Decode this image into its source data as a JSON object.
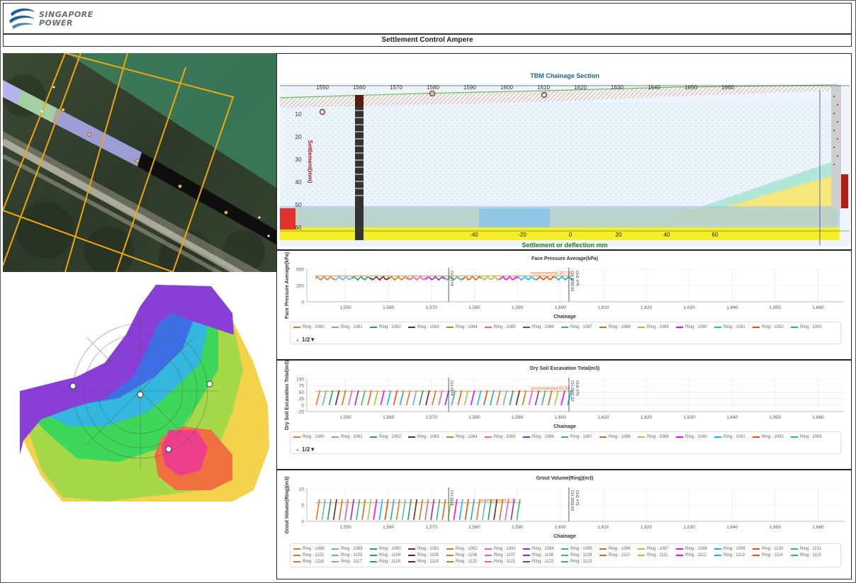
{
  "header": {
    "logo_line1": "SINGAPORE",
    "logo_line2": "POWER",
    "title": "Settlement Control Ampere"
  },
  "colors": {
    "accent_blue": "#1f5f95",
    "recommended": "#e8742a",
    "grid": "#dde3ea"
  },
  "tbm_section": {
    "title": "TBM Chainage Section",
    "chainage_ticks": [
      "1550",
      "1560",
      "1570",
      "1580",
      "1590",
      "1600",
      "1610",
      "1620",
      "1630",
      "1640",
      "1650",
      "1660"
    ],
    "depth_ticks": [
      "10",
      "20",
      "30",
      "40",
      "50",
      "60"
    ],
    "settlement_label": "Settlement(mm)",
    "deflection_label": "Settlement or deflection mm",
    "deflection_ticks": [
      "-40",
      "-20",
      "0",
      "20",
      "40",
      "60"
    ]
  },
  "charts": [
    {
      "id": "face-pressure",
      "title": "Face Pressure Average(kPa)",
      "ylabel": "Face Pressure Average(kPa)",
      "xlabel": "Chainage",
      "yticks": [
        "500",
        "250",
        "0"
      ],
      "ylim": [
        0,
        500
      ],
      "recommended_label": "recommended 397.00",
      "recommended_value": 397,
      "marker_labels": [
        "CH 1574",
        "CH 1602.02",
        "CH1 #75"
      ],
      "legend_page": "1/2"
    },
    {
      "id": "dry-soil",
      "title": "Dry Soil Excavation Total(m3)",
      "ylabel": "Dry Soil Excavation Total(m3)",
      "xlabel": "Chainage",
      "yticks": [
        "100",
        "75",
        "50",
        "25",
        "0",
        "-25"
      ],
      "ylim": [
        -25,
        100
      ],
      "recommended_label": "recommended 53.50",
      "recommended_value": 53.5,
      "marker_labels": [
        "CH 1574",
        "CH 1602.02",
        "CH1 #75"
      ],
      "legend_page": "1/2"
    },
    {
      "id": "grout",
      "title": "Grout Volume(Ring)(m3)",
      "ylabel": "Grout Volume(Ring)(m3)",
      "xlabel": "Chainage",
      "yticks": [
        "10",
        "5",
        "0"
      ],
      "ylim": [
        0,
        10
      ],
      "recommended_label": "recommended 5.70",
      "recommended_value": 5.7,
      "marker_labels": [
        "CH 1574",
        "CH 1602.02",
        "CH1 #75"
      ],
      "legend_page": ""
    }
  ],
  "chart_data": [
    {
      "type": "line",
      "title": "Face Pressure Average(kPa)",
      "xlabel": "Chainage",
      "ylabel": "Face Pressure Average(kPa)",
      "x_ticks": [
        1550,
        1560,
        1570,
        1580,
        1590,
        1600,
        1610,
        1620,
        1630,
        1640,
        1650,
        1660
      ],
      "ylim": [
        0,
        500
      ],
      "recommended": 397,
      "series_note": "one line per ring, Ring : 1080 to Ring : 1093 shown on page 1/2",
      "legend": [
        "Ring : 1080",
        "Ring : 1081",
        "Ring : 1082",
        "Ring : 1083",
        "Ring : 1084",
        "Ring : 1085",
        "Ring : 1086",
        "Ring : 1087",
        "Ring : 1088",
        "Ring : 1089",
        "Ring : 1090",
        "Ring : 1091",
        "Ring : 1092",
        "Ring : 1093"
      ],
      "x_range": [
        1543,
        1603
      ],
      "y_level": 360
    },
    {
      "type": "line",
      "title": "Dry Soil Excavation Total(m3)",
      "xlabel": "Chainage",
      "ylabel": "Dry Soil Excavation Total(m3)",
      "x_ticks": [
        1550,
        1560,
        1570,
        1580,
        1590,
        1600,
        1610,
        1620,
        1630,
        1640,
        1650,
        1660
      ],
      "ylim": [
        -25,
        100
      ],
      "recommended": 53.5,
      "legend": [
        "Ring : 1080",
        "Ring : 1081",
        "Ring : 1082",
        "Ring : 1083",
        "Ring : 1084",
        "Ring : 1085",
        "Ring : 1086",
        "Ring : 1087",
        "Ring : 1088",
        "Ring : 1089",
        "Ring : 1090",
        "Ring : 1091",
        "Ring : 1092",
        "Ring : 1093"
      ],
      "x_range": [
        1543,
        1603
      ],
      "y_level": 50
    },
    {
      "type": "line",
      "title": "Grout Volume(Ring)(m3)",
      "xlabel": "Chainage",
      "ylabel": "Grout Volume(Ring)(m3)",
      "x_ticks": [
        1550,
        1560,
        1570,
        1580,
        1590,
        1600,
        1610,
        1620,
        1630,
        1640,
        1650,
        1660
      ],
      "ylim": [
        0,
        10
      ],
      "recommended": 5.7,
      "legend": [
        "Ring : 1088",
        "Ring : 1089",
        "Ring : 1090",
        "Ring : 1091",
        "Ring : 1092",
        "Ring : 1093",
        "Ring : 1094",
        "Ring : 1095",
        "Ring : 1096",
        "Ring : 1097",
        "Ring : 1098",
        "Ring : 1099",
        "Ring : 1100",
        "Ring : 1101",
        "Ring : 1102",
        "Ring : 1103",
        "Ring : 1104",
        "Ring : 1105",
        "Ring : 1106",
        "Ring : 1107",
        "Ring : 1108",
        "Ring : 1109",
        "Ring : 1110",
        "Ring : 1111",
        "Ring : 1112",
        "Ring : 1113",
        "Ring : 1114",
        "Ring : 1115",
        "Ring : 1116",
        "Ring : 1117",
        "Ring : 1118",
        "Ring : 1119",
        "Ring : 1120",
        "Ring : 1121",
        "Ring : 1122",
        "Ring : 1123"
      ],
      "x_range": [
        1543,
        1591
      ],
      "y_level": 5.6
    }
  ],
  "series_colors": [
    "#e8742a",
    "#6aaed6",
    "#2a9d5c",
    "#7a1d1d",
    "#b8860b",
    "#ff55aa",
    "#8a2be2",
    "#3cb371",
    "#d2691e",
    "#9acd32",
    "#ff00ff",
    "#00bfff",
    "#ff4500",
    "#20b2aa"
  ]
}
